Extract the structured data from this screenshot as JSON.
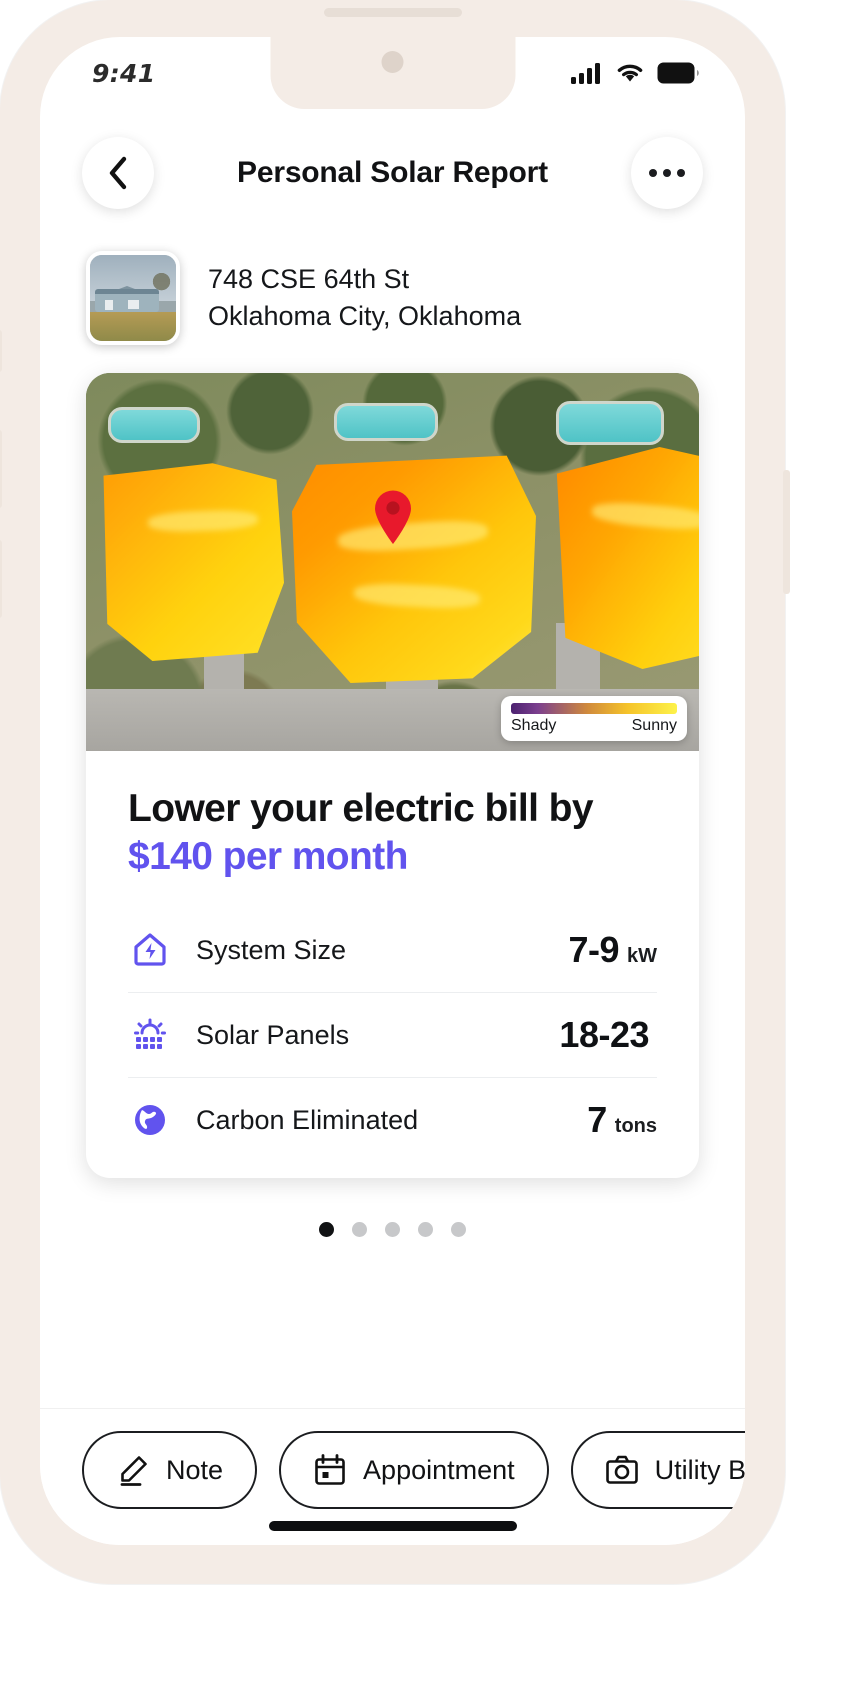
{
  "status_bar": {
    "time": "9:41",
    "cellular_icon": "signal-bars-icon",
    "wifi_icon": "wifi-icon",
    "battery_icon": "battery-full-icon"
  },
  "navbar": {
    "back_icon": "chevron-left-icon",
    "title": "Personal Solar Report",
    "more_icon": "more-horizontal-icon"
  },
  "property": {
    "thumbnail_icon": "house-photo-thumbnail",
    "address_line1": "748 CSE 64th St",
    "address_line2": "Oklahoma City, Oklahoma"
  },
  "map": {
    "pin_icon": "map-pin-icon",
    "legend": {
      "low_label": "Shady",
      "high_label": "Sunny",
      "gradient_start": "#4b2170",
      "gradient_end": "#fdf24a"
    }
  },
  "summary": {
    "headline": "Lower your electric bill by",
    "accent_line": "$140 per month",
    "accent_color": "#6153ee"
  },
  "stats": [
    {
      "icon": "house-bolt-icon",
      "label": "System Size",
      "value": "7-9",
      "unit": "kW"
    },
    {
      "icon": "solar-panel-icon",
      "label": "Solar Panels",
      "value": "18-23",
      "unit": ""
    },
    {
      "icon": "globe-icon",
      "label": "Carbon Eliminated",
      "value": "7",
      "unit": "tons"
    }
  ],
  "pagination": {
    "total": 5,
    "active_index": 0
  },
  "actions": [
    {
      "icon": "pencil-icon",
      "label": "Note"
    },
    {
      "icon": "calendar-icon",
      "label": "Appointment"
    },
    {
      "icon": "camera-icon",
      "label": "Utility Bill"
    }
  ]
}
